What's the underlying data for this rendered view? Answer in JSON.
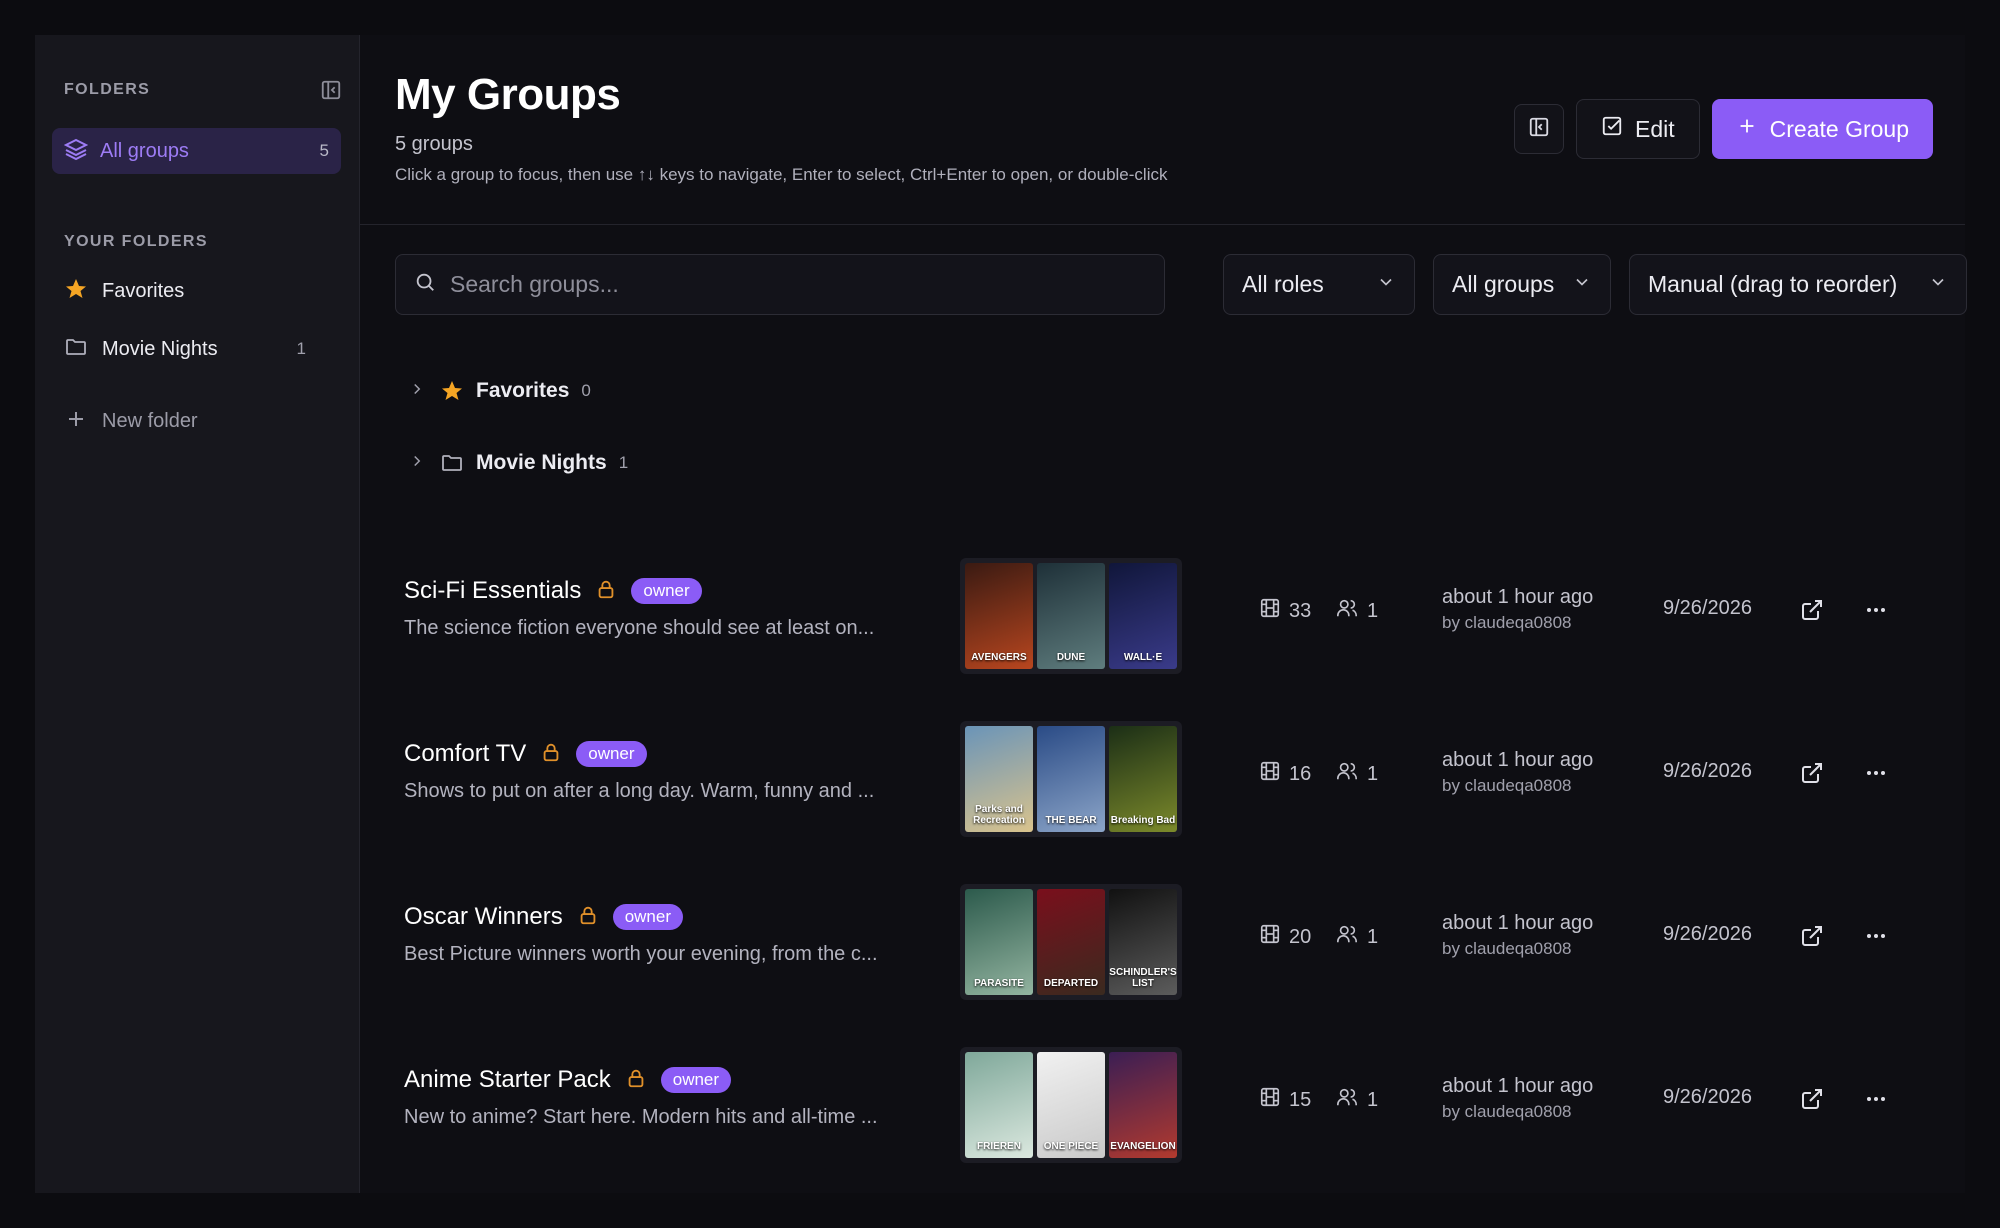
{
  "sidebar": {
    "header": "FOLDERS",
    "all_groups": {
      "label": "All groups",
      "count": "5"
    },
    "section_label": "YOUR FOLDERS",
    "folders": [
      {
        "label": "Favorites",
        "count": ""
      },
      {
        "label": "Movie Nights",
        "count": "1"
      }
    ],
    "new_folder": "New folder"
  },
  "header": {
    "title": "My Groups",
    "subtitle": "5 groups",
    "hint": "Click a group to focus, then use ↑↓ keys to navigate, Enter to select, Ctrl+Enter to open, or double-click",
    "edit_label": "Edit",
    "create_label": "Create Group"
  },
  "filters": {
    "search_placeholder": "Search groups...",
    "roles": "All roles",
    "groups": "All groups",
    "sort": "Manual (drag to reorder)"
  },
  "folder_rows": [
    {
      "label": "Favorites",
      "count": "0"
    },
    {
      "label": "Movie Nights",
      "count": "1"
    }
  ],
  "groups": [
    {
      "name": "Sci-Fi Essentials",
      "role": "owner",
      "description": "The science fiction everyone should see at least on...",
      "posters": [
        {
          "title": "AVENGERS",
          "colors": [
            "#3a1a12",
            "#b8461f"
          ]
        },
        {
          "title": "DUNE",
          "colors": [
            "#1e3038",
            "#5f7d7e"
          ]
        },
        {
          "title": "WALL·E",
          "colors": [
            "#10163a",
            "#3a3b8a"
          ]
        }
      ],
      "titles": "33",
      "members": "1",
      "updated": "about 1 hour ago",
      "by": "by claudeqa0808",
      "date": "9/26/2026"
    },
    {
      "name": "Comfort TV",
      "role": "owner",
      "description": "Shows to put on after a long day. Warm, funny and ...",
      "posters": [
        {
          "title": "Parks and Recreation",
          "colors": [
            "#6a94b8",
            "#d9c38d"
          ]
        },
        {
          "title": "THE BEAR",
          "colors": [
            "#2a4b86",
            "#8ca5c8"
          ]
        },
        {
          "title": "Breaking Bad",
          "colors": [
            "#1b2e16",
            "#7c8a2b"
          ]
        }
      ],
      "titles": "16",
      "members": "1",
      "updated": "about 1 hour ago",
      "by": "by claudeqa0808",
      "date": "9/26/2026"
    },
    {
      "name": "Oscar Winners",
      "role": "owner",
      "description": "Best Picture winners worth your evening, from the c...",
      "posters": [
        {
          "title": "PARASITE",
          "colors": [
            "#2c5a4c",
            "#93b4a0"
          ]
        },
        {
          "title": "DEPARTED",
          "colors": [
            "#7a0f1c",
            "#3a2a1f"
          ]
        },
        {
          "title": "SCHINDLER'S LIST",
          "colors": [
            "#111111",
            "#5c5c5c"
          ]
        }
      ],
      "titles": "20",
      "members": "1",
      "updated": "about 1 hour ago",
      "by": "by claudeqa0808",
      "date": "9/26/2026"
    },
    {
      "name": "Anime Starter Pack",
      "role": "owner",
      "description": "New to anime? Start here. Modern hits and all-time ...",
      "posters": [
        {
          "title": "FRIEREN",
          "colors": [
            "#7fa89a",
            "#dbe8df"
          ]
        },
        {
          "title": "ONE PIECE",
          "colors": [
            "#f1f1f1",
            "#c9c9c9"
          ]
        },
        {
          "title": "EVANGELION",
          "colors": [
            "#3b1e54",
            "#b23a2e"
          ]
        }
      ],
      "titles": "15",
      "members": "1",
      "updated": "about 1 hour ago",
      "by": "by claudeqa0808",
      "date": "9/26/2026"
    }
  ],
  "colors": {
    "accent": "#8b5cf6",
    "star": "#f5a524",
    "lock": "#e0902a"
  }
}
